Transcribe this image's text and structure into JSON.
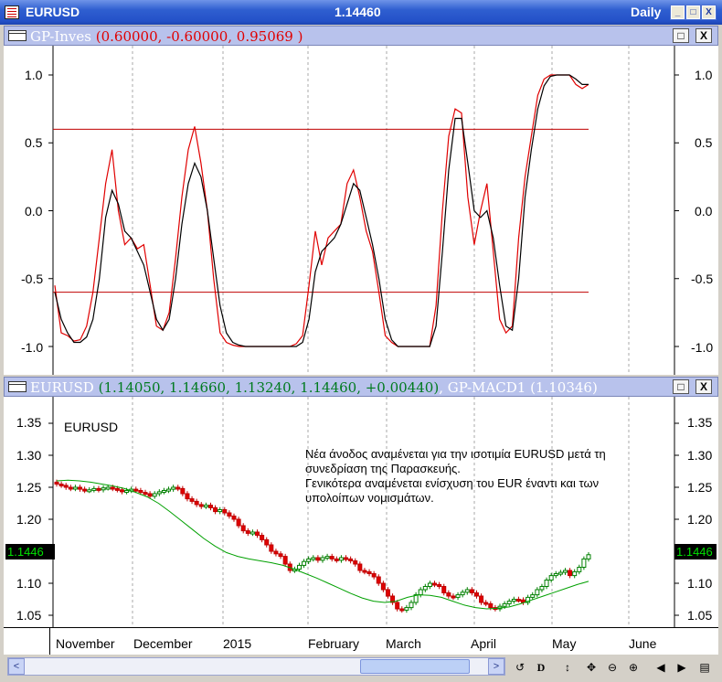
{
  "window": {
    "symbol": "EURUSD",
    "price": "1.14460",
    "period": "Daily",
    "buttons": [
      "_",
      "□",
      "X"
    ]
  },
  "indicator_pane": {
    "name": "GP-Inves",
    "params": "(0.60000, -0.60000, 0.95069 )",
    "btn_max": "□",
    "btn_close": "X",
    "y_ticks": [
      "1.0",
      "0.5",
      "0.0",
      "-0.5",
      "-1.0"
    ]
  },
  "price_pane": {
    "symbol": "EURUSD",
    "ohlc": "(1.14050, 1.14660, 1.13240, 1.14460, +0.00440)",
    "indicator": "GP-MACD1",
    "indicator_value": "(1.10346)",
    "btn_max": "□",
    "btn_close": "X",
    "label": "EURUSD",
    "y_ticks": [
      "1.35",
      "1.30",
      "1.25",
      "1.20",
      "1.15",
      "1.10",
      "1.05"
    ],
    "current_price": "1.1446",
    "annotation": [
      "Νέα άνοδος αναμένεται για την ισοτιμία EURUSD μετά τη",
      "συνεδρίαση της Παρασκευής.",
      "Γενικότερα αναμένεται ενίσχυση του EUR έναντι και των",
      "υπολοίπων νομισμάτων."
    ]
  },
  "x_axis": {
    "months": [
      "November",
      "December",
      "2015",
      "February",
      "March",
      "April",
      "May",
      "June"
    ]
  },
  "toolbar": {
    "scroll_left": "<",
    "scroll_right": ">",
    "tools": [
      "↺",
      "D",
      "↕",
      "✥",
      "⊖",
      "⊕",
      "◀",
      "▶",
      "▤"
    ]
  },
  "chart_data": [
    {
      "type": "line",
      "y_range": [
        -1.0,
        1.0
      ],
      "horizontal_lines": [
        0.6,
        -0.6
      ],
      "series": [
        {
          "color": "#e00000",
          "values": [
            -0.55,
            -0.9,
            -0.92,
            -0.96,
            -0.95,
            -0.85,
            -0.6,
            -0.2,
            0.2,
            0.45,
            0.0,
            -0.25,
            -0.2,
            -0.28,
            -0.25,
            -0.55,
            -0.85,
            -0.88,
            -0.75,
            -0.35,
            0.1,
            0.45,
            0.62,
            0.35,
            0.0,
            -0.5,
            -0.9,
            -0.97,
            -0.99,
            -1.0,
            -1.0,
            -1.0,
            -1.0,
            -1.0,
            -1.0,
            -1.0,
            -1.0,
            -1.0,
            -0.98,
            -0.92,
            -0.55,
            -0.15,
            -0.4,
            -0.2,
            -0.15,
            -0.1,
            0.2,
            0.3,
            0.1,
            -0.15,
            -0.3,
            -0.6,
            -0.92,
            -0.97,
            -1.0,
            -1.0,
            -1.0,
            -1.0,
            -1.0,
            -1.0,
            -0.7,
            0.0,
            0.55,
            0.75,
            0.72,
            0.1,
            -0.25,
            0.0,
            0.2,
            -0.3,
            -0.8,
            -0.9,
            -0.85,
            -0.2,
            0.25,
            0.55,
            0.85,
            0.97,
            1.0,
            1.0,
            1.0,
            1.0,
            0.93,
            0.9,
            0.93
          ]
        },
        {
          "color": "#000000",
          "values": [
            -0.6,
            -0.8,
            -0.9,
            -0.97,
            -0.97,
            -0.93,
            -0.8,
            -0.5,
            -0.05,
            0.15,
            0.05,
            -0.15,
            -0.2,
            -0.3,
            -0.4,
            -0.6,
            -0.8,
            -0.88,
            -0.8,
            -0.5,
            -0.1,
            0.2,
            0.35,
            0.25,
            0.0,
            -0.35,
            -0.7,
            -0.9,
            -0.97,
            -0.99,
            -1.0,
            -1.0,
            -1.0,
            -1.0,
            -1.0,
            -1.0,
            -1.0,
            -1.0,
            -1.0,
            -0.97,
            -0.8,
            -0.45,
            -0.3,
            -0.25,
            -0.2,
            -0.1,
            0.05,
            0.2,
            0.15,
            -0.05,
            -0.25,
            -0.5,
            -0.8,
            -0.95,
            -1.0,
            -1.0,
            -1.0,
            -1.0,
            -1.0,
            -1.0,
            -0.85,
            -0.3,
            0.3,
            0.68,
            0.68,
            0.35,
            0.0,
            -0.05,
            0.0,
            -0.2,
            -0.55,
            -0.85,
            -0.88,
            -0.5,
            0.1,
            0.45,
            0.75,
            0.92,
            0.99,
            1.0,
            1.0,
            1.0,
            0.97,
            0.93,
            0.93
          ]
        }
      ]
    },
    {
      "type": "candlestick",
      "ylim": [
        1.05,
        1.35
      ],
      "close": [
        1.255,
        1.253,
        1.25,
        1.248,
        1.25,
        1.247,
        1.245,
        1.246,
        1.248,
        1.246,
        1.249,
        1.25,
        1.248,
        1.246,
        1.243,
        1.245,
        1.247,
        1.245,
        1.242,
        1.24,
        1.236,
        1.24,
        1.243,
        1.245,
        1.247,
        1.25,
        1.248,
        1.24,
        1.232,
        1.228,
        1.223,
        1.22,
        1.222,
        1.218,
        1.212,
        1.215,
        1.21,
        1.205,
        1.2,
        1.19,
        1.182,
        1.178,
        1.18,
        1.175,
        1.168,
        1.16,
        1.15,
        1.146,
        1.142,
        1.13,
        1.12,
        1.122,
        1.128,
        1.134,
        1.138,
        1.14,
        1.136,
        1.14,
        1.142,
        1.138,
        1.136,
        1.14,
        1.138,
        1.135,
        1.13,
        1.12,
        1.118,
        1.115,
        1.11,
        1.1,
        1.09,
        1.08,
        1.07,
        1.06,
        1.058,
        1.062,
        1.07,
        1.082,
        1.09,
        1.095,
        1.1,
        1.098,
        1.095,
        1.085,
        1.08,
        1.078,
        1.082,
        1.086,
        1.09,
        1.085,
        1.08,
        1.07,
        1.068,
        1.062,
        1.06,
        1.064,
        1.068,
        1.072,
        1.075,
        1.074,
        1.07,
        1.078,
        1.082,
        1.09,
        1.095,
        1.105,
        1.112,
        1.115,
        1.117,
        1.12,
        1.112,
        1.118,
        1.125,
        1.138,
        1.1446
      ],
      "moving_average": [
        1.26,
        1.261,
        1.26,
        1.258,
        1.255,
        1.252,
        1.248,
        1.242,
        1.235,
        1.225,
        1.212,
        1.198,
        1.184,
        1.17,
        1.158,
        1.148,
        1.142,
        1.138,
        1.135,
        1.132,
        1.128,
        1.122,
        1.115,
        1.108,
        1.1,
        1.092,
        1.084,
        1.077,
        1.072,
        1.07,
        1.072,
        1.078,
        1.082,
        1.081,
        1.078,
        1.072,
        1.066,
        1.062,
        1.06,
        1.061,
        1.063,
        1.068,
        1.074,
        1.08,
        1.086,
        1.092,
        1.098,
        1.103
      ]
    }
  ]
}
